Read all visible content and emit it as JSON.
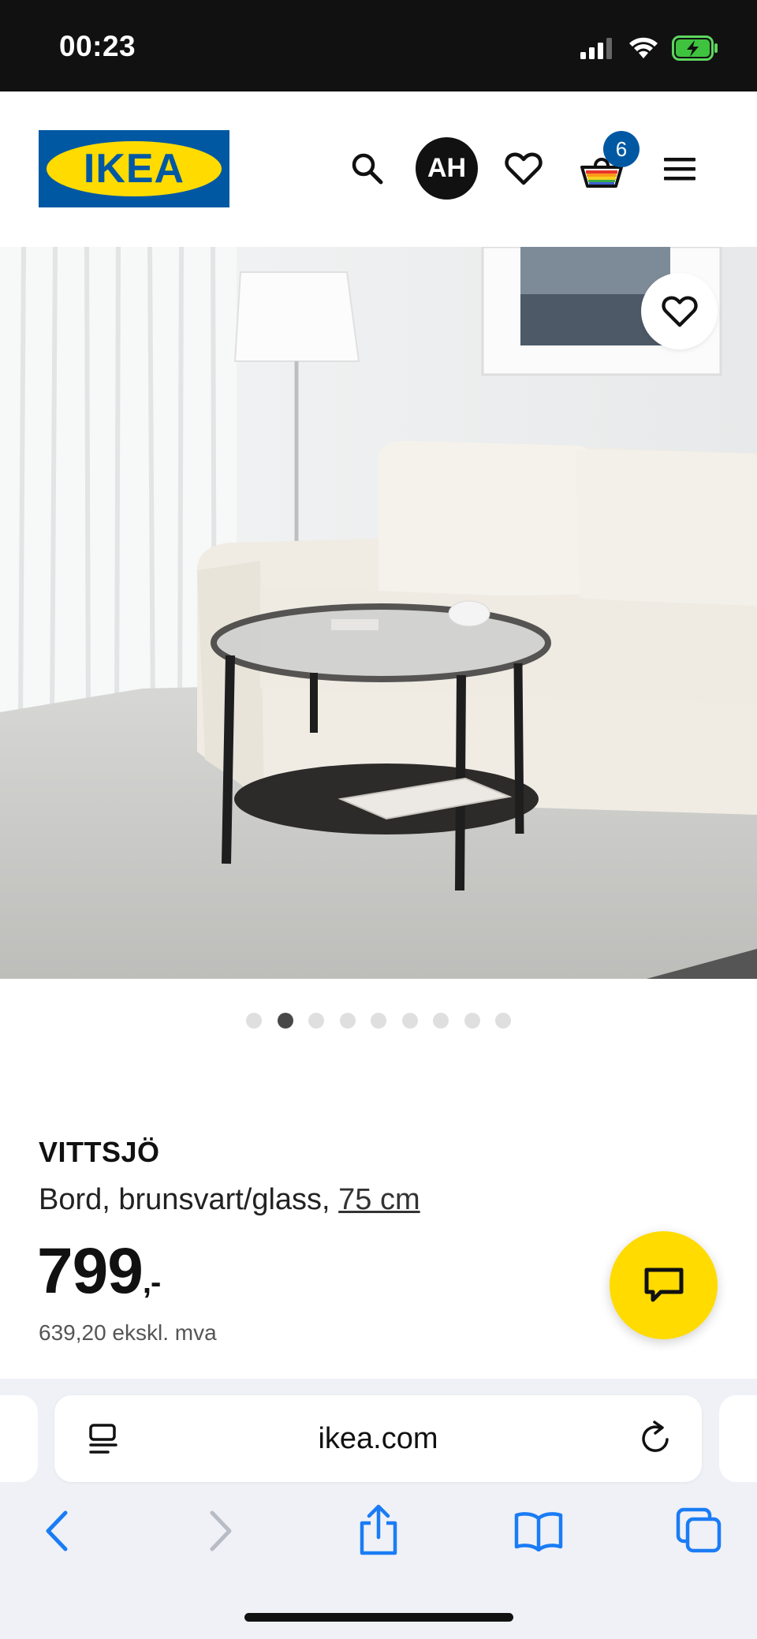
{
  "status_bar": {
    "time": "00:23"
  },
  "header": {
    "logo_text": "IKEA",
    "avatar_initials": "AH",
    "cart_count": "6",
    "icons": [
      "search-icon",
      "heart-icon",
      "basket-icon",
      "menu-icon"
    ]
  },
  "gallery": {
    "dot_count": 9,
    "active_index": 1
  },
  "product": {
    "name": "VITTSJÖ",
    "description": "Bord, brunsvart/glass, ",
    "size_link": "75 cm",
    "price": "799",
    "price_suffix": ",-",
    "price_excl_vat": "639,20 ekskl. mva"
  },
  "browser": {
    "url": "ikea.com",
    "icons": [
      "reader-icon",
      "reload-icon",
      "back-icon",
      "forward-icon",
      "share-icon",
      "bookmarks-icon",
      "tabs-icon"
    ]
  },
  "colors": {
    "ikea_blue": "#0058a3",
    "ikea_yellow": "#ffdb00",
    "safari_blue": "#1a7cf5"
  }
}
